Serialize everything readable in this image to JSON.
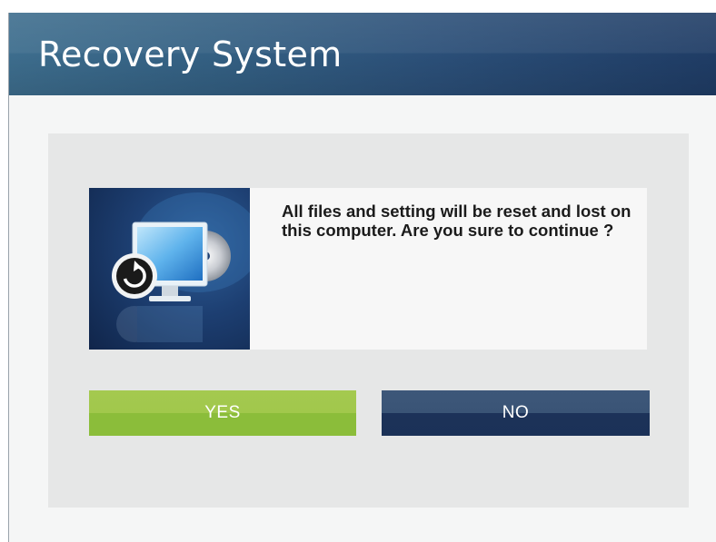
{
  "window": {
    "title": "Recovery System"
  },
  "dialog": {
    "message": "All files and setting will be reset and lost on this computer. Are you sure to continue ?",
    "image_icon": "computer-recovery-icon"
  },
  "buttons": {
    "yes_label": "YES",
    "no_label": "NO"
  },
  "colors": {
    "titlebar": "#2b4f78",
    "yes_button": "#8bbd3a",
    "no_button": "#1c3259",
    "panel": "#e6e7e7"
  }
}
